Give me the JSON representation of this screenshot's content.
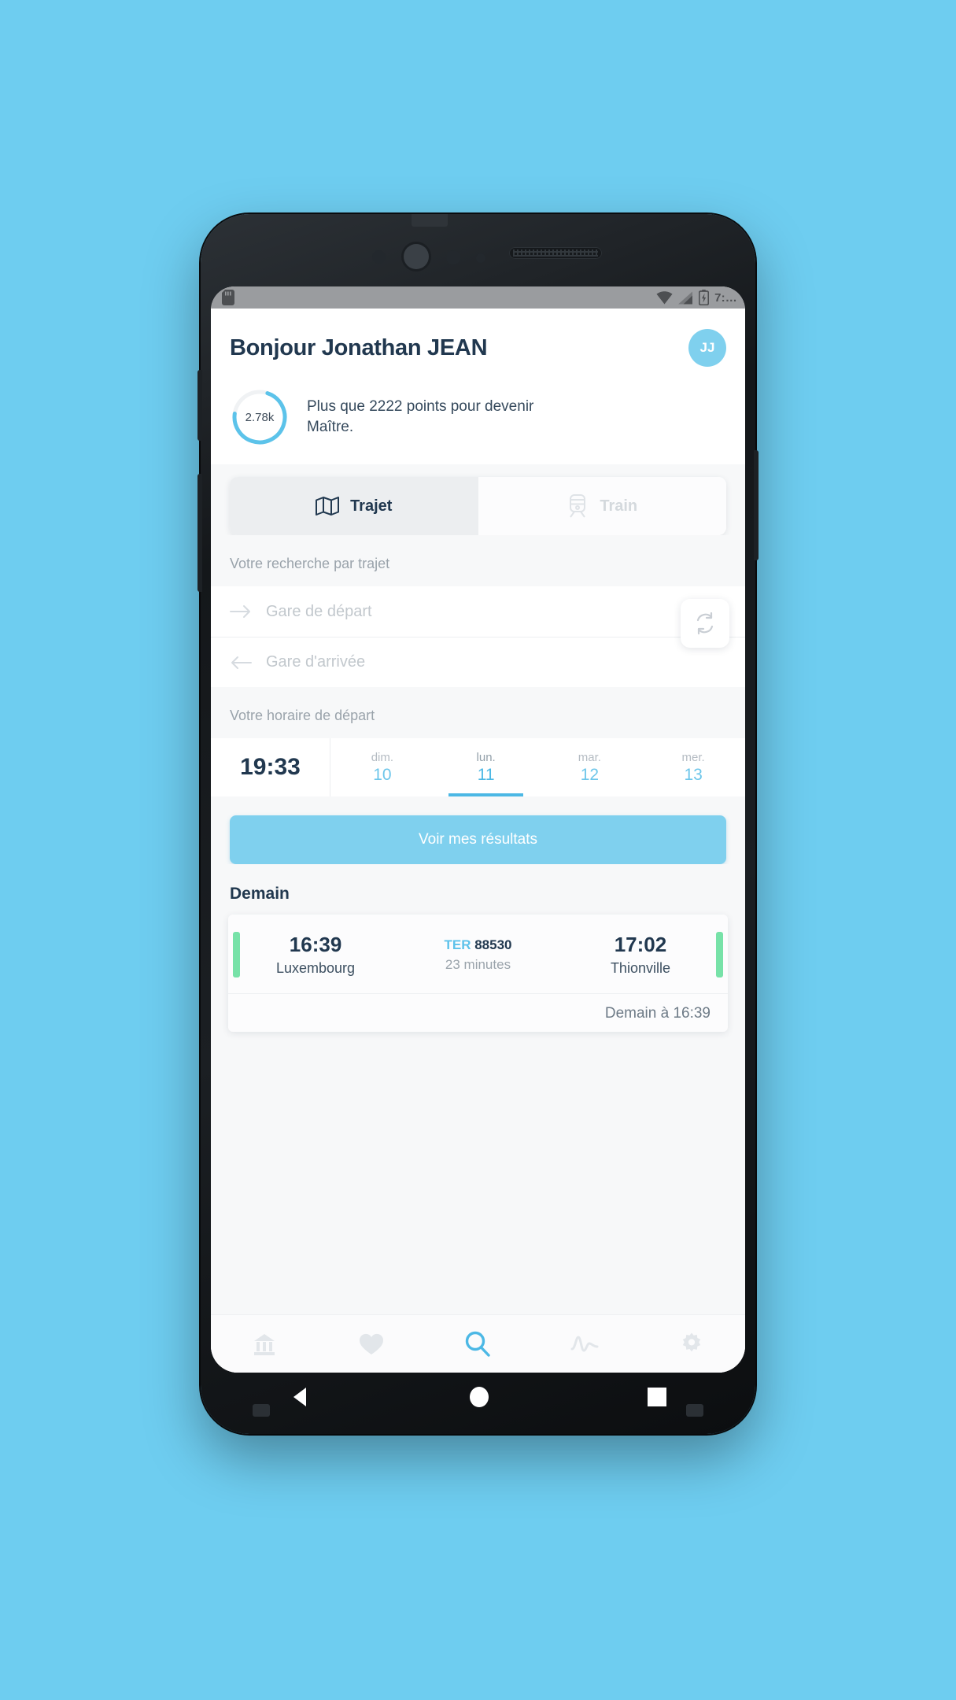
{
  "status_bar": {
    "time": "7:…",
    "icons": [
      "sd-card-icon",
      "wifi-icon",
      "cellular-signal-icon",
      "battery-charging-icon"
    ]
  },
  "header": {
    "greeting": "Bonjour Jonathan JEAN",
    "avatar_initials": "JJ",
    "points_value": "2.78k",
    "points_message": "Plus que 2222 points pour devenir Maître.",
    "ring_progress_percent": 72
  },
  "tabs": [
    {
      "label": "Trajet",
      "icon": "map-icon",
      "active": true
    },
    {
      "label": "Train",
      "icon": "train-icon",
      "active": false
    }
  ],
  "search": {
    "section_label": "Votre recherche par trajet",
    "departure_placeholder": "Gare de départ",
    "departure_value": "",
    "arrival_placeholder": "Gare d'arrivée",
    "arrival_value": "",
    "swap_icon": "swap-refresh-icon"
  },
  "schedule": {
    "section_label": "Votre horaire de départ",
    "time": "19:33",
    "dates": [
      {
        "dow": "dim.",
        "num": "10",
        "selected": false
      },
      {
        "dow": "lun.",
        "num": "11",
        "selected": true
      },
      {
        "dow": "mar.",
        "num": "12",
        "selected": false
      },
      {
        "dow": "mer.",
        "num": "13",
        "selected": false
      }
    ]
  },
  "cta": {
    "label": "Voir mes résultats"
  },
  "results": {
    "heading": "Demain",
    "items": [
      {
        "departure_time": "16:39",
        "departure_station": "Luxembourg",
        "arrival_time": "17:02",
        "arrival_station": "Thionville",
        "train_type": "TER",
        "train_number": "88530",
        "duration": "23 minutes",
        "footer": "Demain à 16:39",
        "status_color": "#77e2a8"
      }
    ]
  },
  "bottom_nav": [
    {
      "name": "station-icon",
      "active": false
    },
    {
      "name": "heart-icon",
      "active": false
    },
    {
      "name": "search-icon",
      "active": true
    },
    {
      "name": "activity-pulse-icon",
      "active": false
    },
    {
      "name": "gear-icon",
      "active": false
    }
  ],
  "android_nav": [
    "back-icon",
    "home-icon",
    "recents-icon"
  ],
  "colors": {
    "accent": "#7fd0ee",
    "accent_dark": "#4cb8e5",
    "text_dark": "#21384f",
    "page_bg": "#6ecdf0",
    "status_green": "#77e2a8"
  }
}
